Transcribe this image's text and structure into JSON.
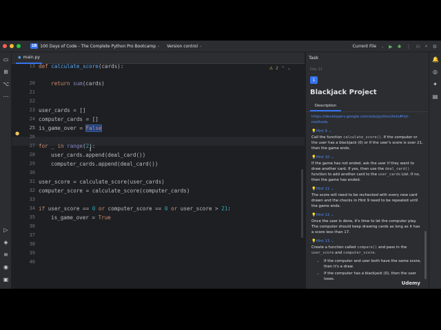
{
  "window": {
    "project_badge": "1B",
    "project_name": "100 Days of Code - The Complete Python Pro Bootcamp",
    "vcs_label": "Version control",
    "run_config": "Current File"
  },
  "editor": {
    "tab_label": "main.py",
    "inspection_count": "2",
    "line_numbers": [
      "13",
      "20",
      "21",
      "22",
      "23",
      "24",
      "25",
      "26",
      "27",
      "28",
      "29",
      "30",
      "31",
      "32",
      "33",
      "34",
      "35",
      "36",
      "37",
      "38",
      "39",
      "40"
    ],
    "lines": {
      "l13_def": "def",
      "l13_name": "calculate_score",
      "l13_rest": "(cards):",
      "l20_return": "return",
      "l20_sum": "sum",
      "l20_rest": "(cards)",
      "l23": "user_cards = []",
      "l24": "computer_cards = []",
      "l25_a": "is_game_over = ",
      "l25_sel": "False",
      "l27_for": "for",
      "l27_mid": " _ ",
      "l27_in": "in",
      "l27_range": "range",
      "l27_open": "(",
      "l27_num": "2",
      "l27_close": "):",
      "l28": "user_cards.append(deal_card())",
      "l29": "computer_cards.append(deal_card())",
      "l31": "user_score = calculate_score(user_cards)",
      "l32": "computer_score = calculate_score(computer_cards)",
      "l34_if": "if",
      "l34_a": " user_score == ",
      "l34_n1": "0",
      "l34_or1": "or",
      "l34_b": " computer_score == ",
      "l34_n2": "0",
      "l34_or2": "or",
      "l34_c": " user_score > ",
      "l34_n3": "21",
      "l34_end": ":",
      "l35_a": "is_game_over = ",
      "l35_true": "True"
    }
  },
  "task": {
    "header": "Task",
    "day": "Day 11",
    "number": "1",
    "title": "Blackjack Project",
    "tab": "Description",
    "link_text": "https://developers.google.com/edu/python/lists#list-methods",
    "hint9": "Hint 9",
    "hint9_text_a": "Call the function ",
    "hint9_code": "calculate_score()",
    "hint9_text_b": ". If the computer or the user has a blackjack (0) or if the user's score is over 21, then the game ends.",
    "hint10": "Hint 10",
    "hint10_text_a": "If the game has not ended, ask the user if they want to draw another card. If yes, then use the ",
    "hint10_code1": "deal_card()",
    "hint10_text_b": " function to add another card to the ",
    "hint10_code2": "user_cards",
    "hint10_text_c": " List. If no, then the game has ended.",
    "hint11": "Hint 11",
    "hint11_text": "The score will need to be rechecked with every new card drawn and the checks in Hint 9 need to be repeated until the game ends.",
    "hint12": "Hint 12",
    "hint12_text": "Once the user is done, it's time to let the computer play. The computer should keep drawing cards as long as it has a score less than 17.",
    "hint13": "Hint 13",
    "hint13_text_a": "Create a function called ",
    "hint13_code1": "compare()",
    "hint13_text_b": " and pass in the ",
    "hint13_code2": "user_score",
    "hint13_text_c": " and ",
    "hint13_code3": "computer_score",
    "hint13_text_d": ".",
    "bullet1": "If the computer and user both have the same score, then it's a draw.",
    "bullet2": "If the computer has a blackjack (0), then the user loses."
  },
  "watermark": "Udemy"
}
